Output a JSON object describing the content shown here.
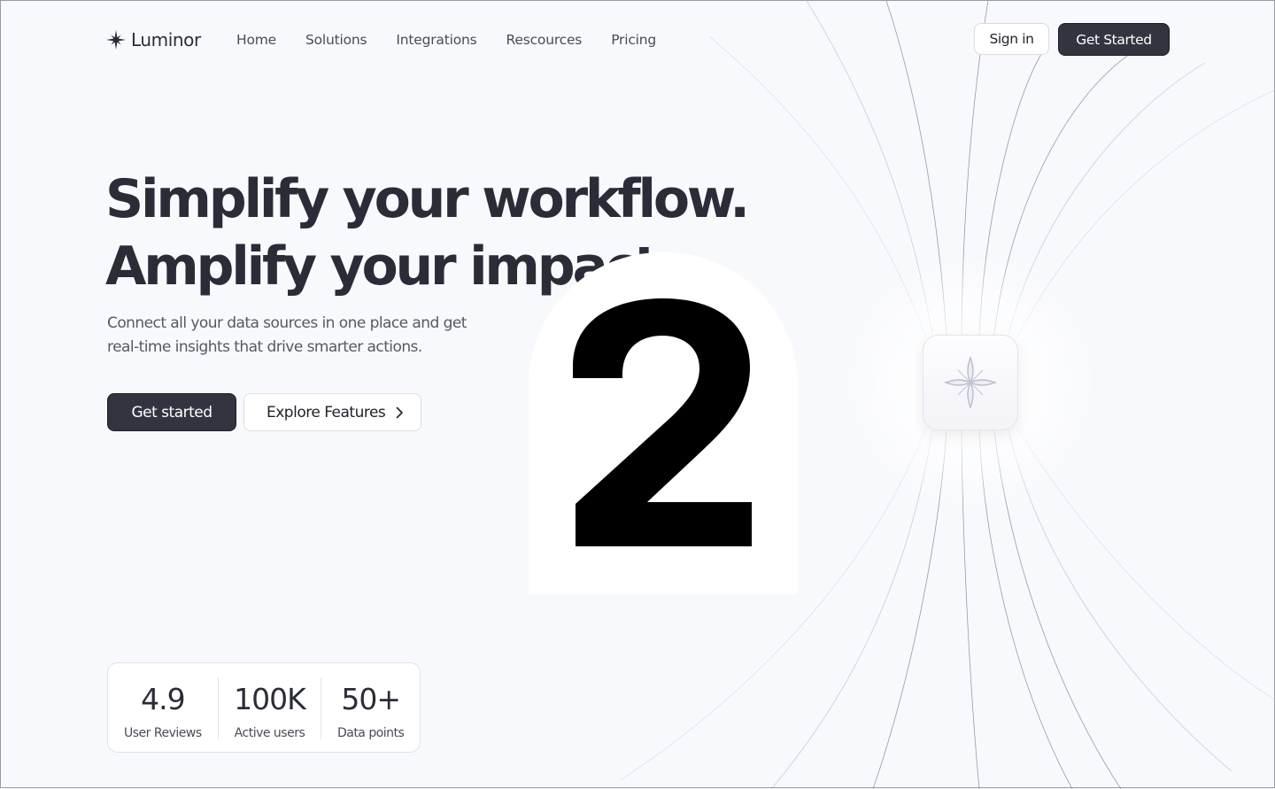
{
  "brand": {
    "name": "Luminor"
  },
  "nav": {
    "items": [
      {
        "label": "Home"
      },
      {
        "label": "Solutions"
      },
      {
        "label": "Integrations"
      },
      {
        "label": "Rescources"
      },
      {
        "label": "Pricing"
      }
    ],
    "signin_label": "Sign in",
    "cta_label": "Get Started"
  },
  "hero": {
    "title_line1": "Simplify your workflow.",
    "title_line2": "Amplify your impact",
    "subtitle": "Connect all your data sources in one place and get real-time insights that drive smarter actions.",
    "primary_cta": "Get started",
    "secondary_cta": "Explore Features"
  },
  "overlay": {
    "digit": "2"
  },
  "stats": [
    {
      "value": "4.9",
      "label": "User Reviews"
    },
    {
      "value": "100K",
      "label": "Active users"
    },
    {
      "value": "50+",
      "label": "Data points"
    }
  ],
  "colors": {
    "background": "#f8f9fd",
    "dark_button": "#33343f",
    "text": "#2b2c38"
  },
  "icons": {
    "logo": "sparkle-icon",
    "center_card": "flower-icon",
    "explore_chevron": "chevron-right-icon"
  }
}
